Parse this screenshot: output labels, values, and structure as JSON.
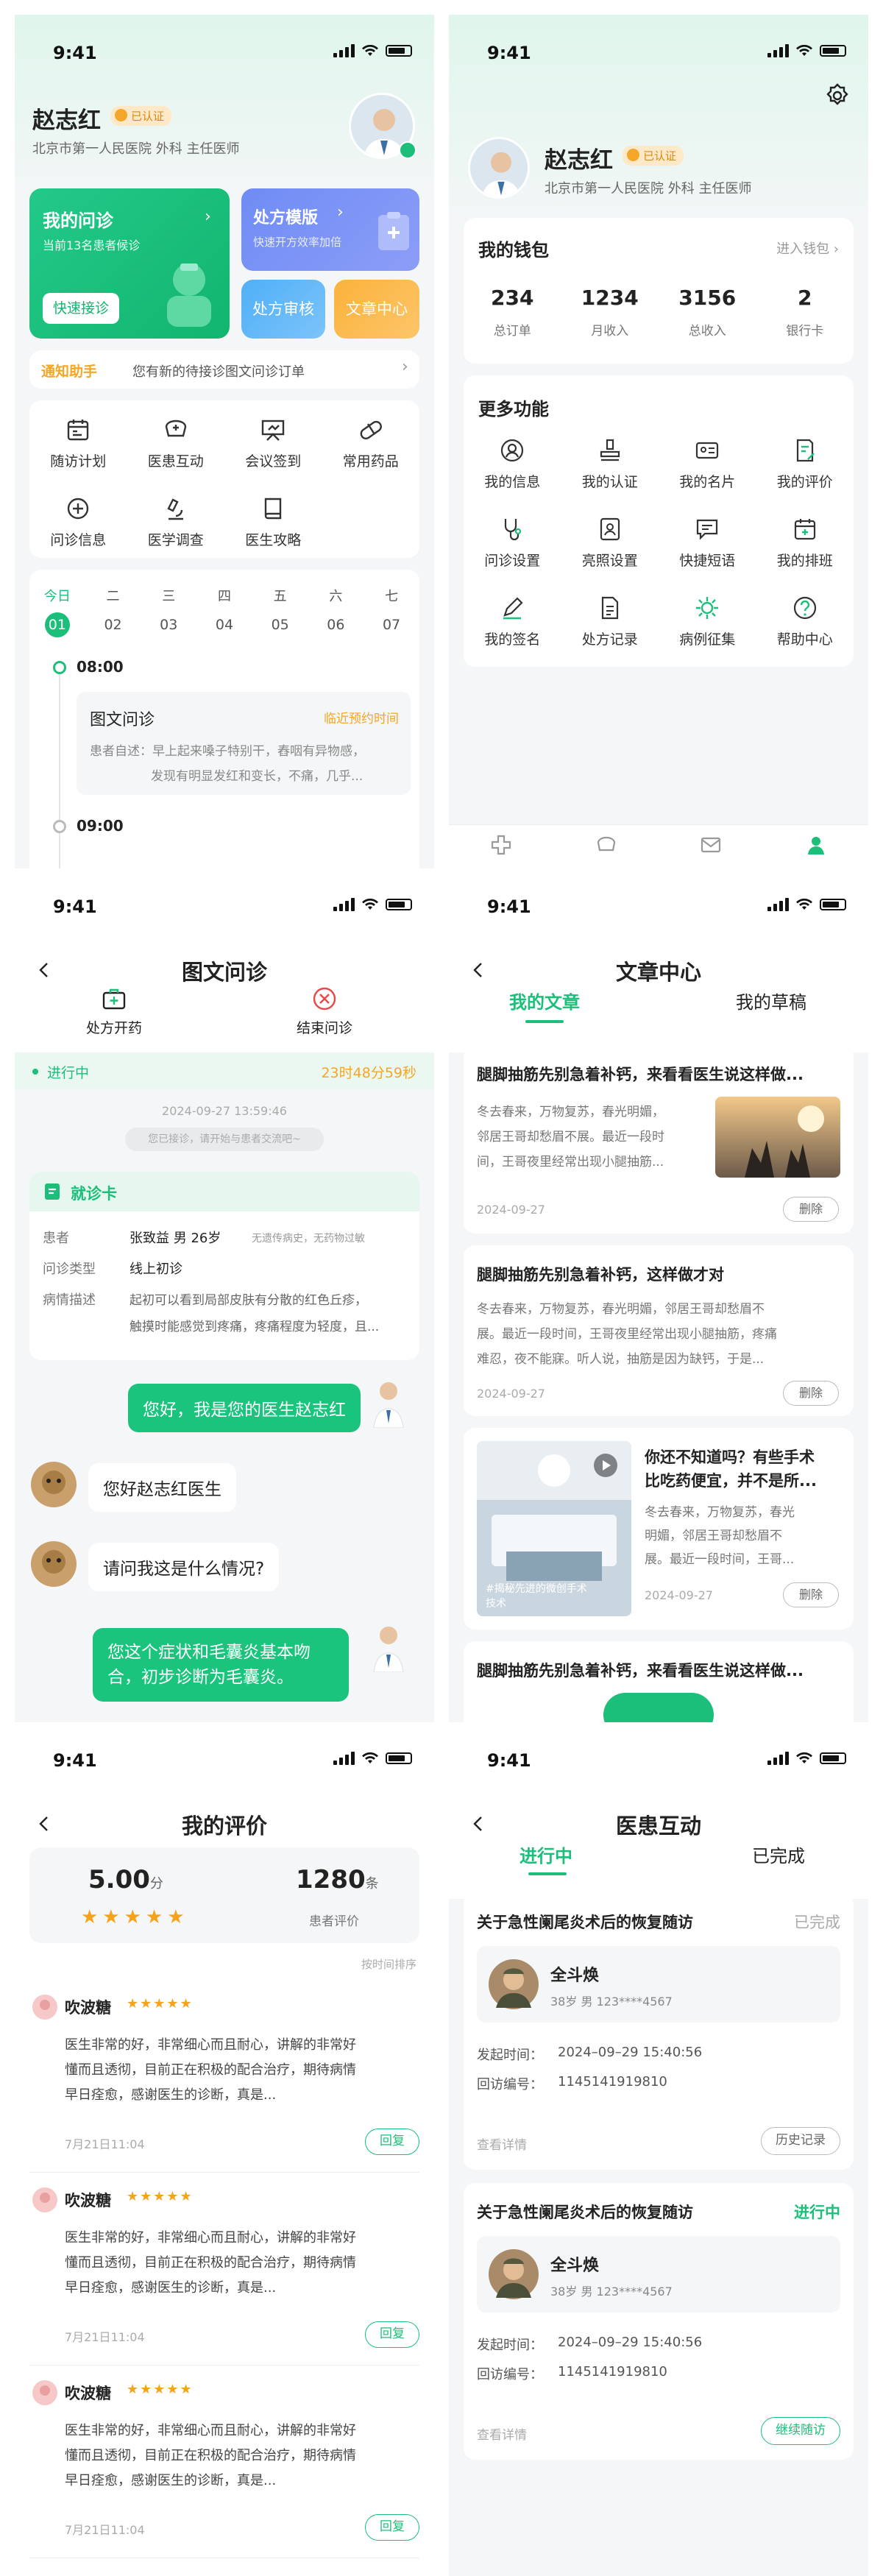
{
  "status": {
    "time": "9:41"
  },
  "s1": {
    "doctor": {
      "name": "赵志红",
      "badge": "已认证",
      "org": "北京市第一人民医院 外科 主任医师"
    },
    "consult": {
      "title": "我的问诊",
      "sub": "当前13名患者候诊",
      "btn": "快速接诊"
    },
    "rx": {
      "title": "处方模版",
      "sub": "快速开方效率加倍"
    },
    "review": "处方审核",
    "articles": "文章中心",
    "notice": {
      "brand": "通知助手",
      "text": "您有新的待接诊图文问诊订单"
    },
    "funcs": [
      "随访计划",
      "医患互动",
      "会议签到",
      "常用药品",
      "问诊信息",
      "医学调查",
      "医生攻略"
    ],
    "week": [
      {
        "d": "今日",
        "n": "01"
      },
      {
        "d": "二",
        "n": "02"
      },
      {
        "d": "三",
        "n": "03"
      },
      {
        "d": "四",
        "n": "04"
      },
      {
        "d": "五",
        "n": "05"
      },
      {
        "d": "六",
        "n": "06"
      },
      {
        "d": "七",
        "n": "07"
      }
    ],
    "slot1": "08:00",
    "slot2": "09:00",
    "appt": {
      "type": "图文问诊",
      "tag": "临近预约时间",
      "desc1": "患者自述：早上起来嗓子特别干，舂咽有异物感，",
      "desc2": "发现有明显发红和变长，不痛，几乎..."
    }
  },
  "s2": {
    "doctor": {
      "name": "赵志红",
      "badge": "已认证",
      "org": "北京市第一人民医院 外科 主任医师"
    },
    "wallet": {
      "title": "我的钱包",
      "link": "进入钱包",
      "stats": [
        {
          "v": "234",
          "l": "总订单"
        },
        {
          "v": "1234",
          "l": "月收入"
        },
        {
          "v": "3156",
          "l": "总收入"
        },
        {
          "v": "2",
          "l": "银行卡"
        }
      ]
    },
    "more": {
      "title": "更多功能",
      "items": [
        "我的信息",
        "我的认证",
        "我的名片",
        "我的评价",
        "问诊设置",
        "亮照设置",
        "快捷短语",
        "我的排班",
        "我的签名",
        "处方记录",
        "病例征集",
        "帮助中心"
      ]
    }
  },
  "s3": {
    "title": "图文问诊",
    "actions": [
      "处方开药",
      "结束问诊"
    ],
    "status": "进行中",
    "countdown": "23时48分59秒",
    "datetime": "2024-09-27 13:59:46",
    "tip": "您已接诊，请开始与患者交流吧~",
    "card": {
      "title": "就诊卡",
      "rows": [
        {
          "k": "患者",
          "v": "张致益  男  26岁",
          "x": "无遗传病史，无药物过敏"
        },
        {
          "k": "问诊类型",
          "v": "线上初诊"
        },
        {
          "k": "病情描述",
          "v": "起初可以看到局部皮肤有分散的红色丘疹，",
          "v2": "触摸时能感觉到疼痛，疼痛程度为轻度，且..."
        }
      ]
    },
    "msgs": [
      "您好，我是您的医生赵志红",
      "您好赵志红医生",
      "请问我这是什么情况?",
      "您这个症状和毛囊炎基本吻",
      "合，初步诊断为毛囊炎。"
    ]
  },
  "s4": {
    "title": "文章中心",
    "tabs": [
      "我的文章",
      "我的草稿"
    ],
    "articles": [
      {
        "title": "腿脚抽筋先别急着补钙，来看看医生说这样做...",
        "l1": "冬去春来，万物复苏，春光明媚，",
        "l2": "邻居王哥却愁眉不展。最近一段时",
        "l3": "间，王哥夜里经常出现小腿抽筋...",
        "date": "2024-09-27",
        "btn": "删除"
      },
      {
        "title": "腿脚抽筋先别急着补钙，这样做才对",
        "l1": "冬去春来，万物复苏，春光明媚，邻居王哥却愁眉不",
        "l2": "展。最近一段时间，王哥夜里经常出现小腿抽筋，疼痛",
        "l3": "难忍，夜不能寐。听人说，抽筋是因为缺钙，于是...",
        "date": "2024-09-27",
        "btn": "删除"
      },
      {
        "title1": "你还不知道吗？有些手术",
        "title2": "比吃药便宜，并不是所...",
        "l1": "冬去春来，万物复苏，春光",
        "l2": "明媚，邻居王哥却愁眉不",
        "l3": "展。最近一段时间，王哥...",
        "date": "2024-09-27",
        "btn": "删除",
        "caption1": "#揭秘先进的微创手术",
        "caption2": "技术"
      },
      {
        "title": "腿脚抽筋先别急着补钙，来看看医生说这样做..."
      }
    ]
  },
  "s5": {
    "title": "我的评价",
    "score": "5.00",
    "scoreUnit": "分",
    "count": "1280",
    "countUnit": "条",
    "countLabel": "患者评价",
    "sort": "按时间排序",
    "reviews": [
      {
        "name": "吹波糖",
        "l1": "医生非常的好，非常细心而且耐心，讲解的非常好",
        "l2": "懂而且透彻，目前正在积极的配合治疗，期待病情",
        "l3": "早日痊愈，感谢医生的诊断，真是...",
        "time": "7月21日11:04",
        "btn": "回复"
      },
      {
        "name": "吹波糖",
        "l1": "医生非常的好，非常细心而且耐心，讲解的非常好",
        "l2": "懂而且透彻，目前正在积极的配合治疗，期待病情",
        "l3": "早日痊愈，感谢医生的诊断，真是...",
        "time": "7月21日11:04",
        "btn": "回复"
      },
      {
        "name": "吹波糖",
        "l1": "医生非常的好，非常细心而且耐心，讲解的非常好",
        "l2": "懂而且透彻，目前正在积极的配合治疗，期待病情",
        "l3": "早日痊愈，感谢医生的诊断，真是...",
        "time": "7月21日11:04",
        "btn": "回复"
      }
    ]
  },
  "s6": {
    "title": "医患互动",
    "tabs": [
      "进行中",
      "已完成"
    ],
    "items": [
      {
        "title": "关于急性阑尾炎术后的恢复随访",
        "status": "已完成",
        "name": "全斗焕",
        "info": "38岁  男  123****4567",
        "k1": "发起时间：",
        "v1": "2024–09–29 15:40:56",
        "k2": "回访编号：",
        "v2": "1145141919810",
        "detail": "查看详情",
        "btn": "历史记录"
      },
      {
        "title": "关于急性阑尾炎术后的恢复随访",
        "status": "进行中",
        "name": "全斗焕",
        "info": "38岁  男  123****4567",
        "k1": "发起时间：",
        "v1": "2024–09–29 15:40:56",
        "k2": "回访编号：",
        "v2": "1145141919810",
        "detail": "查看详情",
        "btn": "继续随访"
      }
    ]
  }
}
